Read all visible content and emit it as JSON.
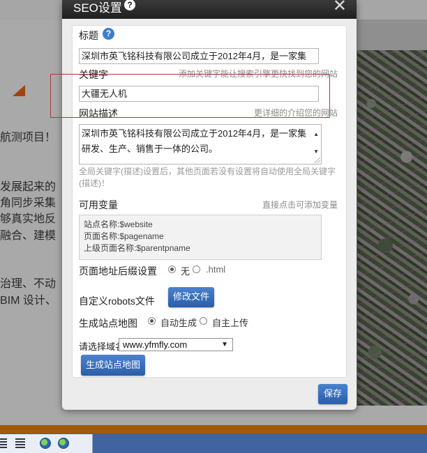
{
  "background": {
    "text_lines": [
      "航测项目！",
      "发展起来的",
      "角同步采集",
      "够真实地反",
      "融合、建模",
      "治理、不动",
      "BIM 设计、"
    ]
  },
  "dialog": {
    "title": "SEO设置",
    "title_help": "?",
    "close": "✕",
    "title_field": {
      "label": "标题",
      "help": "?",
      "value": "深圳市英飞铭科技有限公司成立于2012年4月，是一家集"
    },
    "keywords_field": {
      "label": "关键字",
      "hint": "添加关键字能让搜索引擎更快找到您的网站",
      "value": "大疆无人机"
    },
    "description_field": {
      "label": "网站描述",
      "hint": "更详细的介绍您的网站",
      "value": "深圳市英飞铭科技有限公司成立于2012年4月，是一家集研发、生产、销售于一体的公司。"
    },
    "global_note": "全局关键字(描述)设置后，其他页面若没有设置将自动使用全局关键字(描述)！",
    "variables": {
      "label": "可用变量",
      "hint": "直接点击可添加变量",
      "items": [
        "站点名称:$website",
        "页面名称:$pagename",
        "上级页面名称:$parentpname"
      ]
    },
    "url_suffix": {
      "label": "页面地址后缀设置",
      "options": [
        "无",
        ".html"
      ],
      "selected": "无"
    },
    "robots": {
      "label": "自定义robots文件",
      "button": "修改文件"
    },
    "sitemap": {
      "label": "生成站点地图",
      "options": [
        "自动生成",
        "自主上传"
      ],
      "selected": "自动生成",
      "domain_label": "请选择域名",
      "domain_value": "www.yfmfly.com",
      "generate_button": "生成站点地图"
    },
    "save_button": "保存"
  },
  "colors": {
    "accent_blue": "#2a5ea8",
    "title_bar": "#202020",
    "highlight_border": "#a63a3a"
  }
}
